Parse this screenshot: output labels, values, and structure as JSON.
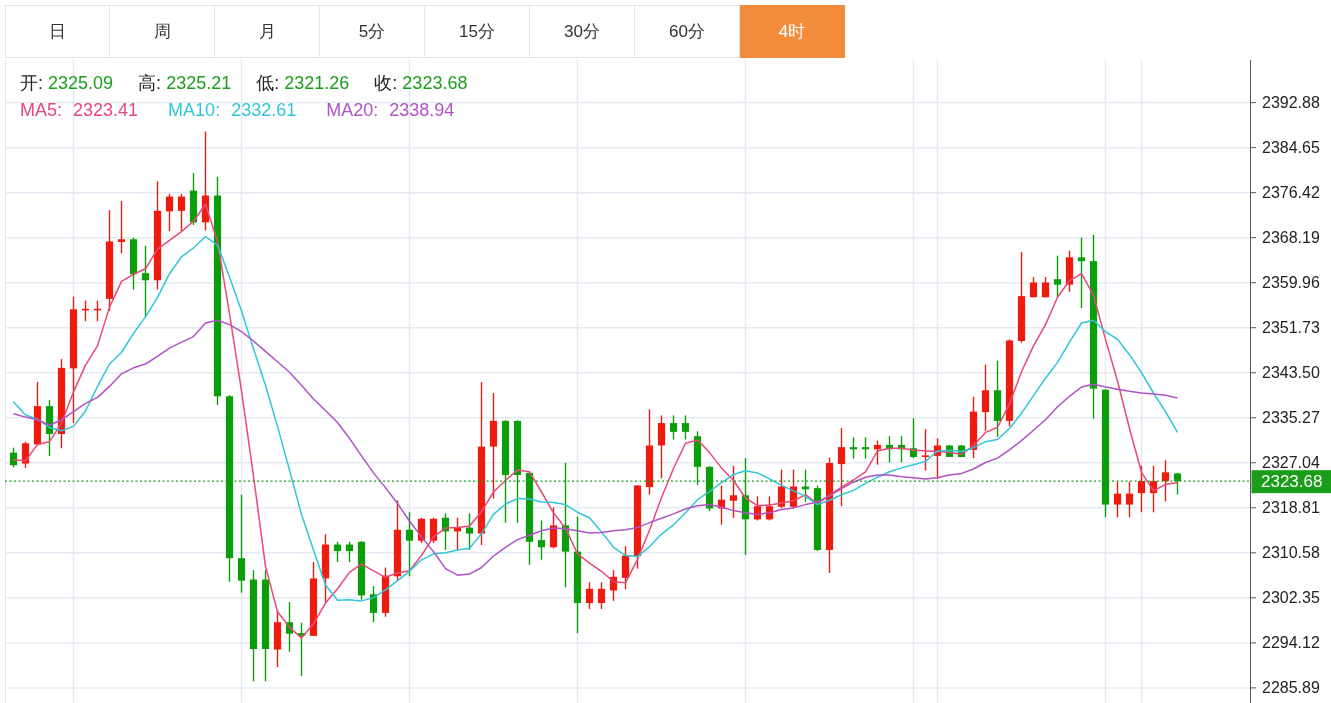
{
  "tabs": [
    {
      "label": "日",
      "selected": false
    },
    {
      "label": "周",
      "selected": false
    },
    {
      "label": "月",
      "selected": false
    },
    {
      "label": "5分",
      "selected": false
    },
    {
      "label": "15分",
      "selected": false
    },
    {
      "label": "30分",
      "selected": false
    },
    {
      "label": "60分",
      "selected": false
    },
    {
      "label": "4时",
      "selected": true
    }
  ],
  "chart": {
    "legend": {
      "ohlc": [
        {
          "label": "开:",
          "value": "2325.09"
        },
        {
          "label": "高:",
          "value": "2325.21"
        },
        {
          "label": "低:",
          "value": "2321.26"
        },
        {
          "label": "收:",
          "value": "2323.68"
        }
      ],
      "moving_averages": [
        {
          "label": "MA5:",
          "value": "2323.41",
          "color": "#e9487a"
        },
        {
          "label": "MA10:",
          "value": "2332.61",
          "color": "#2fc6da"
        },
        {
          "label": "MA20:",
          "value": "2338.94",
          "color": "#b052c6"
        }
      ]
    },
    "chart_data": {
      "type": "candlestick",
      "grid": true,
      "ylim": [
        2283.13,
        2400.67
      ],
      "yticks": [
        2392.88,
        2384.65,
        2376.42,
        2368.19,
        2359.96,
        2351.73,
        {
          "value": 2343.5,
          "label": "2343.50"
        },
        2335.27,
        2327.04,
        2318.81,
        2310.58,
        2302.35,
        2294.12,
        2285.89
      ],
      "ref_lines": [
        {
          "axis": "y",
          "value": 2323.68,
          "label": "2323.68",
          "color": "#1a9e1a"
        }
      ],
      "ohlc": [
        [
          2328.9,
          2329.8,
          2326.2,
          2326.6
        ],
        [
          2326.9,
          2330.9,
          2326.1,
          2330.6
        ],
        [
          2330.4,
          2341.8,
          2330.2,
          2337.4
        ],
        [
          2337.4,
          2338.5,
          2328.3,
          2332.3
        ],
        [
          2332.3,
          2346.0,
          2329.7,
          2344.4
        ],
        [
          2344.3,
          2357.4,
          2334.3,
          2355.1
        ],
        [
          2354.9,
          2356.7,
          2352.9,
          2355.2
        ],
        [
          2354.9,
          2356.7,
          2352.9,
          2355.2
        ],
        [
          2357.0,
          2373.2,
          2354.8,
          2367.5
        ],
        [
          2367.4,
          2374.9,
          2365.3,
          2367.9
        ],
        [
          2367.9,
          2368.2,
          2358.7,
          2361.5
        ],
        [
          2361.7,
          2366.7,
          2353.7,
          2360.4
        ],
        [
          2360.4,
          2378.5,
          2358.7,
          2373.1
        ],
        [
          2373.0,
          2376.2,
          2369.4,
          2375.7
        ],
        [
          2373.1,
          2376.2,
          2369.4,
          2375.7
        ],
        [
          2376.8,
          2380.0,
          2370.5,
          2371.0
        ],
        [
          2371.0,
          2387.6,
          2369.5,
          2375.9
        ],
        [
          2375.9,
          2379.3,
          2337.6,
          2339.2
        ],
        [
          2339.2,
          2339.4,
          2305.3,
          2309.6
        ],
        [
          2309.6,
          2321.2,
          2303.3,
          2305.5
        ],
        [
          2305.7,
          2307.4,
          2287.1,
          2293.0
        ],
        [
          2305.7,
          2307.4,
          2287.1,
          2293.0
        ],
        [
          2292.9,
          2300.1,
          2289.7,
          2297.9
        ],
        [
          2297.9,
          2301.6,
          2292.5,
          2295.8
        ],
        [
          2295.9,
          2297.8,
          2288.1,
          2295.4
        ],
        [
          2295.4,
          2308.9,
          2295.4,
          2305.9
        ],
        [
          2305.9,
          2314.0,
          2301.6,
          2312.1
        ],
        [
          2312.1,
          2312.6,
          2308.9,
          2310.9
        ],
        [
          2312.1,
          2312.6,
          2308.9,
          2310.9
        ],
        [
          2312.6,
          2312.7,
          2302.0,
          2302.8
        ],
        [
          2303.0,
          2304.5,
          2297.9,
          2299.6
        ],
        [
          2299.6,
          2307.9,
          2298.9,
          2306.4
        ],
        [
          2306.3,
          2320.2,
          2305.5,
          2314.8
        ],
        [
          2314.8,
          2318.0,
          2306.3,
          2312.8
        ],
        [
          2312.8,
          2317.0,
          2312.4,
          2316.8
        ],
        [
          2312.8,
          2317.0,
          2312.4,
          2316.8
        ],
        [
          2317.0,
          2317.8,
          2311.1,
          2314.5
        ],
        [
          2314.5,
          2317.0,
          2311.1,
          2315.3
        ],
        [
          2315.2,
          2317.8,
          2311.1,
          2314.1
        ],
        [
          2314.1,
          2341.8,
          2312.0,
          2330.0
        ],
        [
          2330.0,
          2339.8,
          2320.5,
          2334.7
        ],
        [
          2334.7,
          2334.8,
          2316.1,
          2324.8
        ],
        [
          2334.7,
          2334.8,
          2316.1,
          2324.8
        ],
        [
          2325.2,
          2325.3,
          2308.4,
          2312.6
        ],
        [
          2312.9,
          2316.5,
          2309.3,
          2311.6
        ],
        [
          2311.6,
          2318.9,
          2311.4,
          2315.6
        ],
        [
          2315.6,
          2327.0,
          2304.3,
          2310.8
        ],
        [
          2310.8,
          2317.2,
          2295.9,
          2301.4
        ],
        [
          2301.4,
          2305.2,
          2300.3,
          2304.0
        ],
        [
          2301.4,
          2305.2,
          2300.3,
          2304.0
        ],
        [
          2303.7,
          2307.4,
          2301.8,
          2306.2
        ],
        [
          2306.0,
          2311.8,
          2303.9,
          2310.1
        ],
        [
          2310.0,
          2322.9,
          2307.7,
          2322.9
        ],
        [
          2322.6,
          2336.8,
          2321.2,
          2330.2
        ],
        [
          2330.2,
          2335.7,
          2324.2,
          2334.3
        ],
        [
          2334.3,
          2335.7,
          2331.3,
          2332.7
        ],
        [
          2334.3,
          2335.7,
          2331.3,
          2332.7
        ],
        [
          2331.9,
          2332.8,
          2323.0,
          2326.3
        ],
        [
          2326.3,
          2326.4,
          2318.2,
          2318.7
        ],
        [
          2318.7,
          2322.9,
          2315.7,
          2320.3
        ],
        [
          2320.1,
          2326.5,
          2317.0,
          2321.1
        ],
        [
          2321.1,
          2327.9,
          2310.2,
          2316.7
        ],
        [
          2316.7,
          2320.9,
          2316.5,
          2319.1
        ],
        [
          2316.7,
          2320.9,
          2316.5,
          2319.1
        ],
        [
          2319.0,
          2325.8,
          2318.8,
          2322.7
        ],
        [
          2319.0,
          2325.8,
          2318.8,
          2322.7
        ],
        [
          2322.7,
          2325.8,
          2319.9,
          2322.2
        ],
        [
          2322.4,
          2322.9,
          2310.9,
          2311.1
        ],
        [
          2311.1,
          2328.0,
          2306.9,
          2327.0
        ],
        [
          2326.8,
          2333.4,
          2319.1,
          2329.9
        ],
        [
          2329.9,
          2331.7,
          2327.8,
          2329.5
        ],
        [
          2329.9,
          2331.7,
          2327.8,
          2329.5
        ],
        [
          2329.5,
          2331.1,
          2326.7,
          2330.3
        ],
        [
          2330.3,
          2331.9,
          2327.1,
          2329.5
        ],
        [
          2330.3,
          2331.9,
          2327.1,
          2329.5
        ],
        [
          2329.7,
          2335.2,
          2327.9,
          2328.1
        ],
        [
          2328.1,
          2333.2,
          2325.6,
          2328.4
        ],
        [
          2328.3,
          2331.5,
          2324.1,
          2330.2
        ],
        [
          2330.2,
          2330.3,
          2328.1,
          2328.1
        ],
        [
          2330.2,
          2330.3,
          2328.1,
          2328.1
        ],
        [
          2329.4,
          2339.1,
          2327.9,
          2336.4
        ],
        [
          2336.3,
          2345.0,
          2332.9,
          2340.3
        ],
        [
          2340.3,
          2345.7,
          2331.8,
          2334.7
        ],
        [
          2334.7,
          2349.6,
          2333.7,
          2349.4
        ],
        [
          2349.3,
          2365.6,
          2349.0,
          2357.5
        ],
        [
          2357.3,
          2361.0,
          2357.3,
          2360.0
        ],
        [
          2357.3,
          2361.0,
          2357.3,
          2360.0
        ],
        [
          2360.6,
          2364.9,
          2357.3,
          2359.6
        ],
        [
          2359.6,
          2365.8,
          2358.3,
          2364.6
        ],
        [
          2364.6,
          2368.2,
          2355.3,
          2363.9
        ],
        [
          2363.9,
          2368.7,
          2335.1,
          2340.6
        ],
        [
          2340.4,
          2340.5,
          2317.1,
          2319.4
        ],
        [
          2319.4,
          2323.6,
          2317.1,
          2321.4
        ],
        [
          2319.4,
          2323.6,
          2317.1,
          2321.4
        ],
        [
          2321.5,
          2326.5,
          2318.0,
          2323.7
        ],
        [
          2321.5,
          2326.5,
          2318.0,
          2323.7
        ],
        [
          2323.7,
          2327.5,
          2320.0,
          2325.3
        ],
        [
          2325.09,
          2325.21,
          2321.26,
          2323.68
        ]
      ],
      "series": [
        {
          "type": "line",
          "color": "#e9487a",
          "values": [
            2327.6,
            2327.4,
            2330.4,
            2330.9,
            2334.3,
            2340.0,
            2344.9,
            2348.4,
            2355.5,
            2360.2,
            2361.5,
            2362.5,
            2366.1,
            2367.7,
            2369.3,
            2371.2,
            2374.3,
            2367.5,
            2354.3,
            2340.2,
            2324.6,
            2308.1,
            2299.8,
            2297.0,
            2295.0,
            2297.6,
            2301.4,
            2304.0,
            2307.0,
            2308.5,
            2307.3,
            2306.1,
            2306.9,
            2307.3,
            2310.1,
            2313.5,
            2315.1,
            2315.2,
            2315.5,
            2318.1,
            2321.7,
            2323.8,
            2325.7,
            2325.4,
            2321.7,
            2317.9,
            2315.1,
            2310.4,
            2308.7,
            2307.2,
            2305.3,
            2305.1,
            2309.4,
            2314.7,
            2320.7,
            2326.0,
            2330.6,
            2331.2,
            2328.9,
            2326.1,
            2323.8,
            2320.6,
            2319.2,
            2319.3,
            2319.7,
            2320.1,
            2321.2,
            2319.6,
            2321.1,
            2322.6,
            2323.9,
            2325.4,
            2329.2,
            2329.7,
            2329.7,
            2329.4,
            2329.2,
            2329.1,
            2328.9,
            2328.6,
            2330.2,
            2332.6,
            2333.5,
            2337.8,
            2343.7,
            2348.4,
            2352.3,
            2357.3,
            2360.3,
            2361.6,
            2357.7,
            2349.6,
            2342.0,
            2333.3,
            2325.3,
            2321.9,
            2323.1,
            2323.4
          ]
        },
        {
          "type": "line",
          "color": "#2fc6da",
          "values": [
            2338.2,
            2335.8,
            2335.0,
            2333.5,
            2332.9,
            2333.7,
            2336.5,
            2341.0,
            2345.1,
            2347.2,
            2350.7,
            2353.7,
            2357.3,
            2361.6,
            2364.7,
            2366.3,
            2368.4,
            2366.8,
            2361.0,
            2354.8,
            2347.9,
            2341.2,
            2333.7,
            2325.7,
            2317.6,
            2311.1,
            2304.7,
            2301.9,
            2302.0,
            2301.8,
            2302.4,
            2303.8,
            2305.5,
            2307.2,
            2309.3,
            2310.4,
            2310.6,
            2311.1,
            2311.4,
            2314.1,
            2317.6,
            2319.5,
            2320.5,
            2320.4,
            2319.9,
            2319.8,
            2319.4,
            2318.0,
            2317.0,
            2314.4,
            2311.6,
            2310.1,
            2309.9,
            2311.7,
            2314.0,
            2315.7,
            2317.9,
            2320.3,
            2321.8,
            2323.4,
            2324.9,
            2325.6,
            2325.2,
            2324.1,
            2322.9,
            2321.9,
            2320.9,
            2319.4,
            2320.2,
            2321.2,
            2322.0,
            2323.3,
            2324.4,
            2325.4,
            2326.1,
            2326.7,
            2327.3,
            2329.2,
            2329.3,
            2329.1,
            2329.8,
            2330.9,
            2331.3,
            2333.3,
            2336.1,
            2339.3,
            2342.5,
            2345.4,
            2349.1,
            2352.6,
            2353.1,
            2351.0,
            2349.6,
            2346.8,
            2343.5,
            2339.8,
            2336.4,
            2332.6
          ]
        },
        {
          "type": "line",
          "color": "#b052c6",
          "values": [
            2336.0,
            2335.4,
            2334.9,
            2333.9,
            2334.9,
            2336.4,
            2337.9,
            2339.0,
            2341.0,
            2343.3,
            2344.4,
            2345.1,
            2346.5,
            2348.0,
            2349.1,
            2350.1,
            2352.6,
            2353.1,
            2352.3,
            2351.0,
            2349.3,
            2347.4,
            2345.5,
            2343.6,
            2341.2,
            2338.7,
            2336.6,
            2334.4,
            2331.5,
            2328.3,
            2325.2,
            2322.5,
            2319.6,
            2316.4,
            2313.5,
            2310.8,
            2307.7,
            2306.5,
            2306.7,
            2307.9,
            2310.0,
            2311.6,
            2313.0,
            2313.8,
            2314.6,
            2315.1,
            2315.0,
            2314.6,
            2314.2,
            2314.3,
            2314.6,
            2314.8,
            2315.2,
            2316.1,
            2316.9,
            2317.7,
            2318.6,
            2319.2,
            2319.4,
            2318.9,
            2318.3,
            2317.9,
            2317.6,
            2317.9,
            2318.5,
            2318.8,
            2319.4,
            2319.9,
            2321.0,
            2322.3,
            2323.5,
            2324.4,
            2324.8,
            2324.8,
            2324.5,
            2324.3,
            2324.1,
            2324.3,
            2324.8,
            2325.1,
            2325.9,
            2327.1,
            2327.9,
            2329.4,
            2331.1,
            2333.0,
            2334.9,
            2337.3,
            2339.2,
            2340.9,
            2341.4,
            2340.9,
            2340.5,
            2340.1,
            2339.8,
            2339.6,
            2339.4,
            2338.9
          ]
        }
      ]
    }
  }
}
